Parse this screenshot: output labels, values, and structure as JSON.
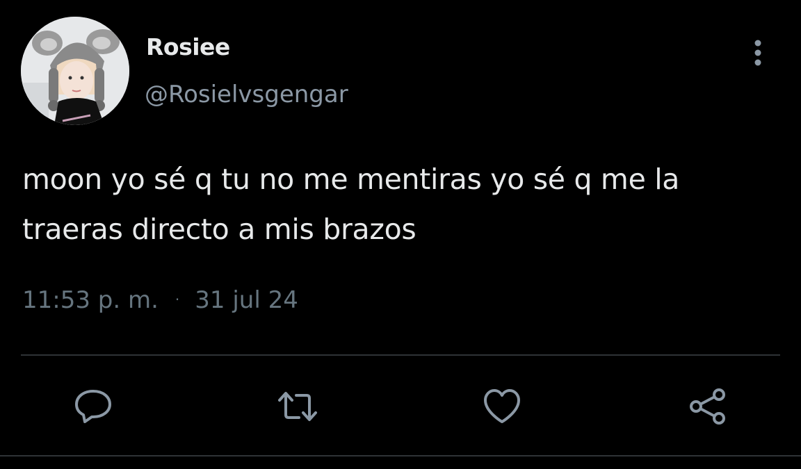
{
  "user": {
    "display_name": "Rosiee",
    "handle": "@Rosielvsgengar",
    "avatar_icon": "profile-photo"
  },
  "tweet": {
    "text": "moon yo sé q tu no me mentiras yo sé q me la traeras directo a mis brazos",
    "time": "11:53 p. m.",
    "separator": "·",
    "date": "31 jul 24"
  },
  "actions": {
    "reply_icon": "speech-bubble-icon",
    "retweet_icon": "retweet-icon",
    "like_icon": "heart-icon",
    "share_icon": "share-icon"
  },
  "colors": {
    "background": "#000000",
    "primary_text": "#e7e9ea",
    "secondary_text": "#8b98a5",
    "meta_text": "#66757f",
    "icon": "#8b98a5",
    "divider": "#2f3336"
  }
}
